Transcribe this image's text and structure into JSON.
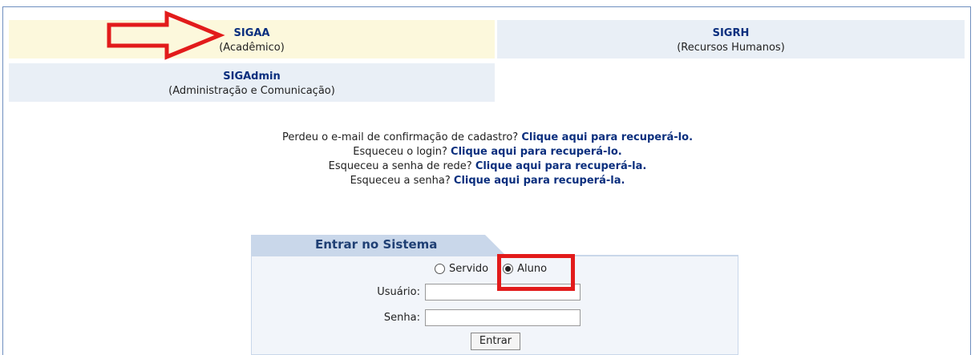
{
  "systems": [
    {
      "name": "SIGAA",
      "desc": "(Acadêmico)"
    },
    {
      "name": "SIGRH",
      "desc": "(Recursos Humanos)"
    },
    {
      "name": "SIGAdmin",
      "desc": "(Administração e Comunicação)"
    }
  ],
  "recover": [
    {
      "text": "Perdeu o e-mail de confirmação de cadastro? ",
      "link": "Clique aqui para recuperá-lo."
    },
    {
      "text": "Esqueceu o login? ",
      "link": "Clique aqui para recuperá-lo."
    },
    {
      "text": "Esqueceu a senha de rede? ",
      "link": "Clique aqui para recuperá-la."
    },
    {
      "text": "Esqueceu a senha? ",
      "link": "Clique aqui para recuperá-la."
    }
  ],
  "login": {
    "title": "Entrar no Sistema",
    "options": [
      "Servido",
      "Aluno"
    ],
    "selected": "Aluno",
    "user_label": "Usuário:",
    "pass_label": "Senha:",
    "user_value": "",
    "pass_value": "",
    "submit": "Entrar"
  },
  "colors": {
    "highlight": "#e21b1b",
    "link": "#0b2f7e"
  }
}
